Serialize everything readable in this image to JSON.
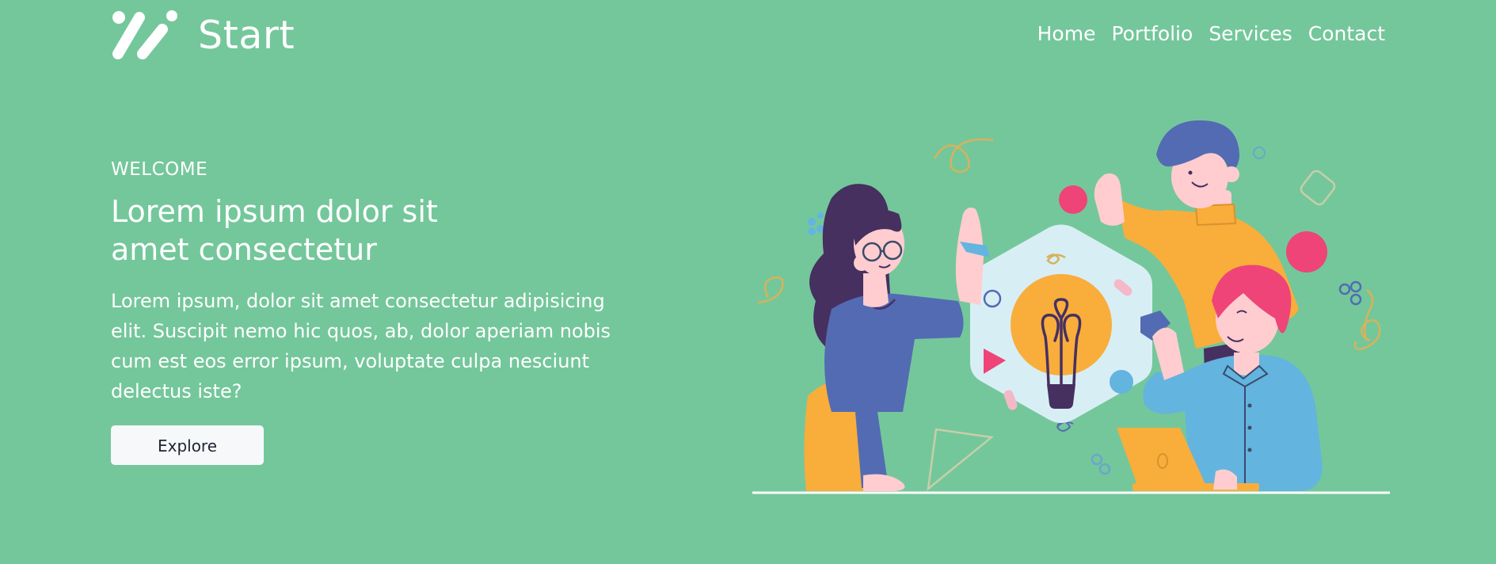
{
  "brand": {
    "name": "Start",
    "logo_icon": "slashes-logo-icon"
  },
  "nav": {
    "items": [
      {
        "label": "Home"
      },
      {
        "label": "Portfolio"
      },
      {
        "label": "Services"
      },
      {
        "label": "Contact"
      }
    ]
  },
  "hero": {
    "eyebrow": "WELCOME",
    "headline": "Lorem ipsum dolor sit amet consectetur",
    "body": "Lorem ipsum, dolor sit amet consectetur adipisicing elit. Suscipit nemo hic quos, ab, dolor aperiam nobis cum est eos error ipsum, voluptate culpa nesciunt delectus iste?",
    "cta_label": "Explore"
  },
  "illustration": {
    "subject": "team-brainstorm-lightbulb-illustration"
  },
  "colors": {
    "background": "#74c79b",
    "text": "#ffffff",
    "button_bg": "#f7f8fa",
    "button_text": "#1e2530",
    "accent_yellow": "#f9ad3b",
    "accent_blue": "#536bb3",
    "accent_pink": "#ee4478",
    "accent_sky": "#63b4df",
    "hex_panel": "#d8eef5",
    "dark_purple": "#463060"
  }
}
